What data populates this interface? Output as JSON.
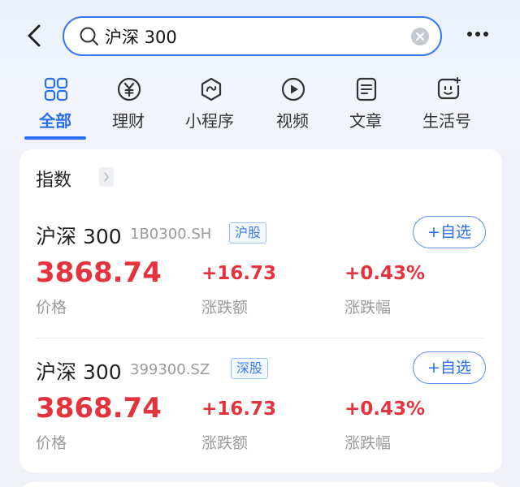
{
  "search": {
    "query": "沪深 300"
  },
  "tabs": [
    {
      "label": "全部",
      "icon": "grid-icon",
      "active": true
    },
    {
      "label": "理财",
      "icon": "yen-icon",
      "active": false
    },
    {
      "label": "小程序",
      "icon": "mini-program-icon",
      "active": false
    },
    {
      "label": "视频",
      "icon": "play-icon",
      "active": false
    },
    {
      "label": "文章",
      "icon": "article-icon",
      "active": false
    },
    {
      "label": "生活号",
      "icon": "life-account-icon",
      "active": false
    }
  ],
  "section": {
    "title": "指数"
  },
  "results": [
    {
      "name": "沪深 300",
      "code": "1B0300.SH",
      "market": "沪股",
      "watch_label": "+自选",
      "price": "3868.74",
      "price_label": "价格",
      "change": "+16.73",
      "change_label": "涨跌额",
      "change_pct": "+0.43%",
      "change_pct_label": "涨跌幅"
    },
    {
      "name": "沪深 300",
      "code": "399300.SZ",
      "market": "深股",
      "watch_label": "+自选",
      "price": "3868.74",
      "price_label": "价格",
      "change": "+16.73",
      "change_label": "涨跌额",
      "change_pct": "+0.43%",
      "change_pct_label": "涨跌幅"
    }
  ],
  "colors": {
    "accent": "#2a6ff2",
    "up": "#e5333d",
    "muted": "#9a9a9a"
  }
}
